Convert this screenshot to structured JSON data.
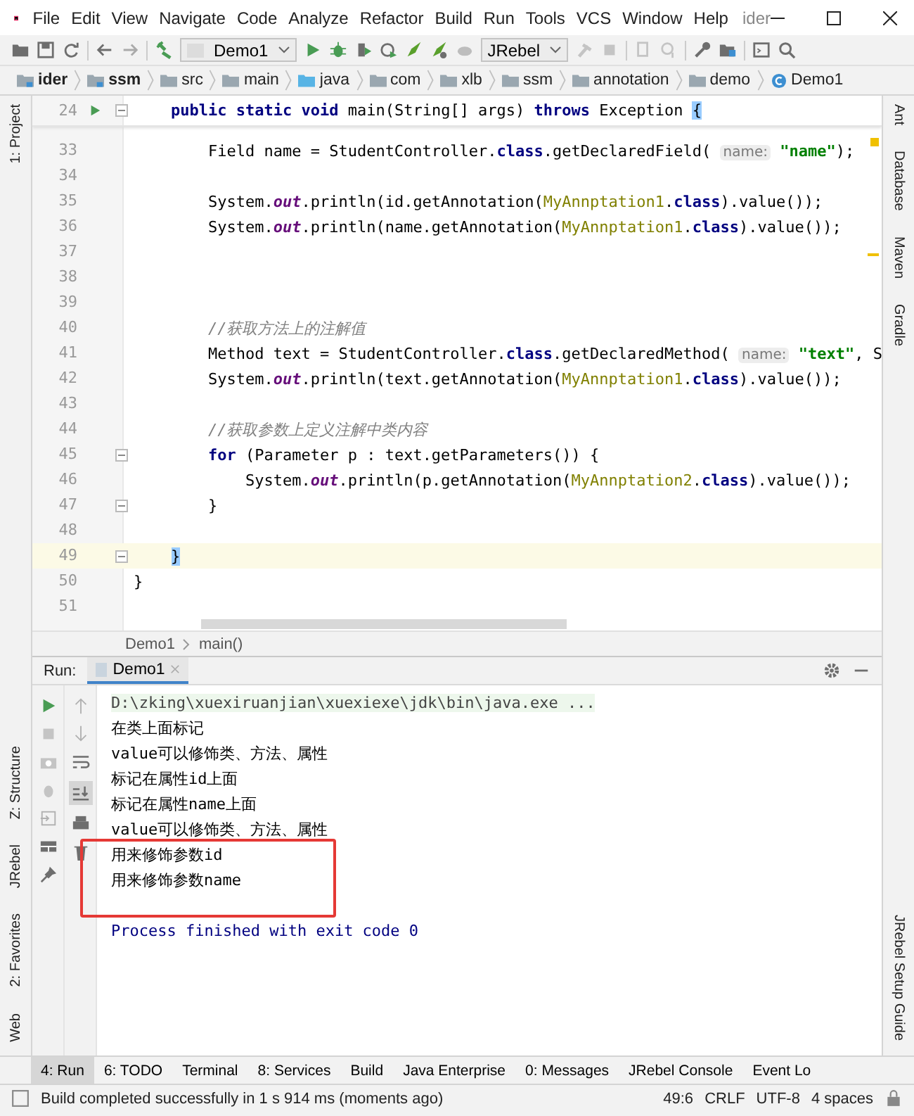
{
  "window": {
    "title": "ider",
    "menu": [
      "File",
      "Edit",
      "View",
      "Navigate",
      "Code",
      "Analyze",
      "Refactor",
      "Build",
      "Run",
      "Tools",
      "VCS",
      "Window",
      "Help"
    ]
  },
  "toolbar": {
    "run_config": "Demo1",
    "jrebel": "JRebel"
  },
  "breadcrumbs": [
    {
      "label": "ider",
      "kind": "module"
    },
    {
      "label": "ssm",
      "kind": "module"
    },
    {
      "label": "src",
      "kind": "folder"
    },
    {
      "label": "main",
      "kind": "folder"
    },
    {
      "label": "java",
      "kind": "source"
    },
    {
      "label": "com",
      "kind": "package"
    },
    {
      "label": "xlb",
      "kind": "package"
    },
    {
      "label": "ssm",
      "kind": "package"
    },
    {
      "label": "annotation",
      "kind": "package"
    },
    {
      "label": "demo",
      "kind": "package"
    },
    {
      "label": "Demo1",
      "kind": "class"
    }
  ],
  "left_stripe": {
    "top": [
      "1: Project"
    ],
    "bottom": [
      "Z: Structure",
      "JRebel",
      "2: Favorites",
      "Web"
    ]
  },
  "right_stripe": {
    "top": [
      "Ant",
      "Database",
      "Maven",
      "Gradle"
    ],
    "bottom": [
      "JRebel Setup Guide"
    ]
  },
  "editor": {
    "sticky": {
      "number": "24",
      "fold": true,
      "tokens": [
        {
          "kind": "kw",
          "text": "    public static void "
        },
        {
          "kind": "plain",
          "text": "main(String[] args) "
        },
        {
          "kind": "kw",
          "text": "throws"
        },
        {
          "kind": "plain",
          "text": " Exception "
        },
        {
          "kind": "match",
          "text": "{"
        }
      ]
    },
    "lines": [
      {
        "number": "33",
        "fold": false,
        "current": false,
        "tokens": [
          {
            "kind": "plain",
            "text": "        Field name = StudentController."
          },
          {
            "kind": "kw",
            "text": "class"
          },
          {
            "kind": "plain",
            "text": ".getDeclaredField( "
          },
          {
            "kind": "hint",
            "text": "name:"
          },
          {
            "kind": "str",
            "text": " \"name\""
          },
          {
            "kind": "plain",
            "text": ");"
          }
        ]
      },
      {
        "number": "34",
        "fold": false,
        "current": false
      },
      {
        "number": "35",
        "fold": false,
        "current": false,
        "tokens": [
          {
            "kind": "plain",
            "text": "        System."
          },
          {
            "kind": "static",
            "text": "out"
          },
          {
            "kind": "plain",
            "text": ".println(id.getAnnotation("
          },
          {
            "kind": "ann",
            "text": "MyAnnptation1"
          },
          {
            "kind": "plain",
            "text": "."
          },
          {
            "kind": "kw",
            "text": "class"
          },
          {
            "kind": "plain",
            "text": ").value());"
          }
        ]
      },
      {
        "number": "36",
        "fold": false,
        "current": false,
        "tokens": [
          {
            "kind": "plain",
            "text": "        System."
          },
          {
            "kind": "static",
            "text": "out"
          },
          {
            "kind": "plain",
            "text": ".println(name.getAnnotation("
          },
          {
            "kind": "ann",
            "text": "MyAnnptation1"
          },
          {
            "kind": "plain",
            "text": "."
          },
          {
            "kind": "kw",
            "text": "class"
          },
          {
            "kind": "plain",
            "text": ").value());"
          }
        ]
      },
      {
        "number": "37",
        "fold": false,
        "current": false
      },
      {
        "number": "38",
        "fold": false,
        "current": false
      },
      {
        "number": "39",
        "fold": false,
        "current": false
      },
      {
        "number": "40",
        "fold": false,
        "current": false,
        "tokens": [
          {
            "kind": "comment",
            "text": "        //获取方法上的注解值"
          }
        ]
      },
      {
        "number": "41",
        "fold": false,
        "current": false,
        "tokens": [
          {
            "kind": "plain",
            "text": "        Method text = StudentController."
          },
          {
            "kind": "kw",
            "text": "class"
          },
          {
            "kind": "plain",
            "text": ".getDeclaredMethod( "
          },
          {
            "kind": "hint",
            "text": "name:"
          },
          {
            "kind": "str",
            "text": " \"text\""
          },
          {
            "kind": "plain",
            "text": ", S"
          }
        ]
      },
      {
        "number": "42",
        "fold": false,
        "current": false,
        "tokens": [
          {
            "kind": "plain",
            "text": "        System."
          },
          {
            "kind": "static",
            "text": "out"
          },
          {
            "kind": "plain",
            "text": ".println(text.getAnnotation("
          },
          {
            "kind": "ann",
            "text": "MyAnnptation1"
          },
          {
            "kind": "plain",
            "text": "."
          },
          {
            "kind": "kw",
            "text": "class"
          },
          {
            "kind": "plain",
            "text": ").value());"
          }
        ]
      },
      {
        "number": "43",
        "fold": false,
        "current": false
      },
      {
        "number": "44",
        "fold": false,
        "current": false,
        "tokens": [
          {
            "kind": "comment",
            "text": "        //获取参数上定义注解中类内容"
          }
        ]
      },
      {
        "number": "45",
        "fold": true,
        "current": false,
        "tokens": [
          {
            "kind": "kw",
            "text": "        for"
          },
          {
            "kind": "plain",
            "text": " (Parameter p : text.getParameters()) {"
          }
        ]
      },
      {
        "number": "46",
        "fold": false,
        "current": false,
        "tokens": [
          {
            "kind": "plain",
            "text": "            System."
          },
          {
            "kind": "static",
            "text": "out"
          },
          {
            "kind": "plain",
            "text": ".println(p.getAnnotation("
          },
          {
            "kind": "ann",
            "text": "MyAnnptation2"
          },
          {
            "kind": "plain",
            "text": "."
          },
          {
            "kind": "kw",
            "text": "class"
          },
          {
            "kind": "plain",
            "text": ").value());"
          }
        ]
      },
      {
        "number": "47",
        "fold": true,
        "current": false,
        "tokens": [
          {
            "kind": "plain",
            "text": "        }"
          }
        ]
      },
      {
        "number": "48",
        "fold": false,
        "current": false
      },
      {
        "number": "49",
        "fold": true,
        "current": true,
        "tokens": [
          {
            "kind": "match",
            "text": "    }"
          }
        ]
      },
      {
        "number": "50",
        "fold": false,
        "current": false,
        "tokens": [
          {
            "kind": "plain",
            "text": "}"
          }
        ]
      },
      {
        "number": "51",
        "fold": false,
        "current": false
      }
    ],
    "crumbs": [
      "Demo1",
      "main()"
    ]
  },
  "run": {
    "label": "Run:",
    "tab": "Demo1",
    "console": [
      {
        "kind": "cmd",
        "text": "D:\\zking\\xuexiruanjian\\xuexiexe\\jdk\\bin\\java.exe ...",
        "boxed": false
      },
      {
        "kind": "out",
        "text": "在类上面标记",
        "boxed": false
      },
      {
        "kind": "out",
        "text": "value可以修饰类、方法、属性",
        "boxed": false
      },
      {
        "kind": "out",
        "text": "标记在属性id上面",
        "boxed": false
      },
      {
        "kind": "out",
        "text": "标记在属性name上面",
        "boxed": false
      },
      {
        "kind": "out",
        "text": "value可以修饰类、方法、属性",
        "boxed": false
      },
      {
        "kind": "out",
        "text": "用来修饰参数id",
        "boxed": true
      },
      {
        "kind": "out",
        "text": "用来修饰参数name",
        "boxed": true
      },
      {
        "kind": "blank",
        "boxed": false
      },
      {
        "kind": "exit",
        "text": "Process finished with exit code 0",
        "boxed": false
      }
    ]
  },
  "tool_tabs": [
    {
      "label": "4: Run",
      "selected": true
    },
    {
      "label": "6: TODO",
      "selected": false
    },
    {
      "label": "Terminal",
      "selected": false
    },
    {
      "label": "8: Services",
      "selected": false
    },
    {
      "label": "Build",
      "selected": false
    },
    {
      "label": "Java Enterprise",
      "selected": false
    },
    {
      "label": "0: Messages",
      "selected": false
    },
    {
      "label": "JRebel Console",
      "selected": false
    },
    {
      "label": "Event Lo",
      "selected": false
    }
  ],
  "status_bar": {
    "message": "Build completed successfully in 1 s 914 ms (moments ago)",
    "position": "49:6",
    "line_ending": "CRLF",
    "encoding": "UTF-8",
    "indent": "4 spaces"
  }
}
